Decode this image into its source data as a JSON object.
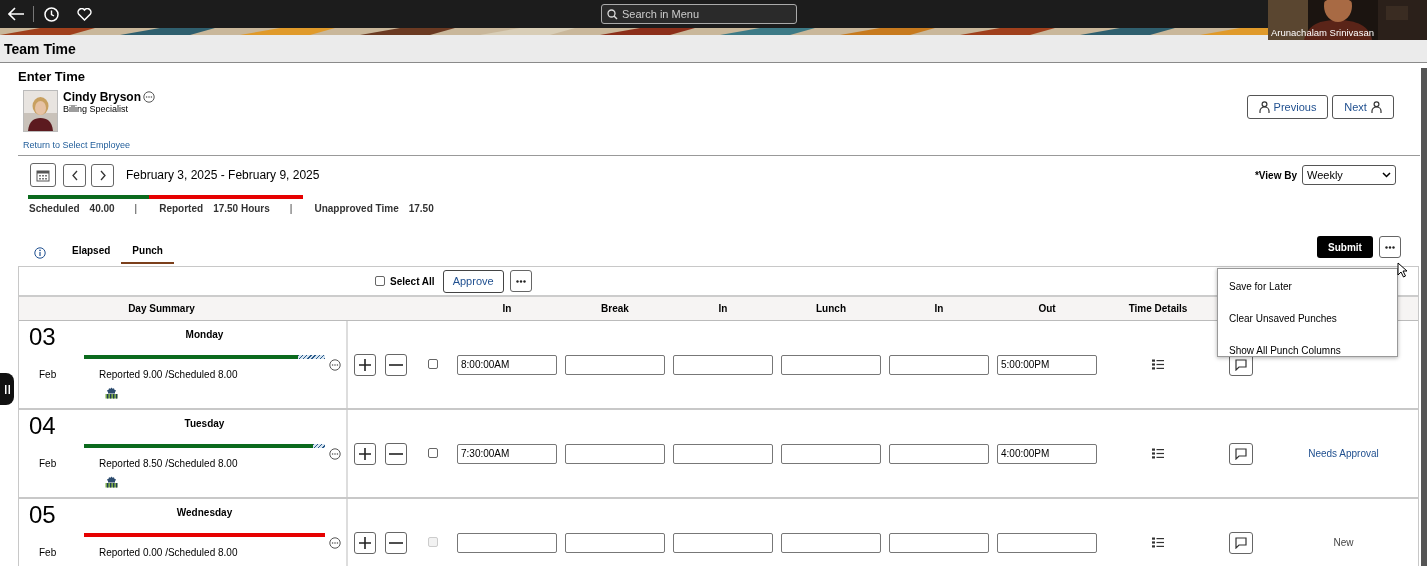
{
  "top_bar": {
    "search": {
      "placeholder": "Search in Menu"
    }
  },
  "video_overlay": {
    "participant": "Arunachalam Srinivasan"
  },
  "page_title": "Team Time",
  "section_title": "Enter Time",
  "employee": {
    "name": "Cindy Bryson",
    "job_title": "Billing Specialist",
    "return_link": "Return to Select Employee"
  },
  "nav_buttons": [
    {
      "label": "Previous"
    },
    {
      "label": "Next"
    }
  ],
  "period": {
    "range": "February 3, 2025 - February 9, 2025",
    "level": 0.44,
    "totals": [
      {
        "label": "Scheduled",
        "value": "40.00",
        "separator": "|"
      },
      {
        "label": "Reported",
        "value": "17.50 Hours",
        "separator": "|"
      },
      {
        "label": "Unapproved Time",
        "value": "17.50"
      }
    ]
  },
  "view_by": {
    "label": "*View By",
    "value": "Weekly"
  },
  "tabs": [
    {
      "label": "Elapsed",
      "selected": false
    },
    {
      "label": "Punch",
      "selected": true
    }
  ],
  "actions": {
    "submit": "Submit"
  },
  "toolbar": {
    "select_all": {
      "label": "Select All",
      "checked": false
    },
    "approve": "Approve"
  },
  "menu": {
    "items": [
      "Save for Later",
      "Clear Unsaved Punches",
      "Show All Punch Columns"
    ]
  },
  "table": {
    "columns": [
      "Day Summary",
      "In",
      "Break",
      "In",
      "Lunch",
      "In",
      "Out",
      "Time Details"
    ],
    "rows": [
      {
        "day": "03",
        "month": "Feb",
        "weekday": "Monday",
        "level": 0.89,
        "overage": true,
        "summary": "Reported 9.00 /Scheduled 8.00",
        "indicator": true,
        "checked": false,
        "disabled": false,
        "in": "8:00:00AM",
        "out": "5:00:00PM"
      },
      {
        "day": "04",
        "month": "Feb",
        "weekday": "Tuesday",
        "level": 0.95,
        "overage": true,
        "summary": "Reported 8.50 /Scheduled 8.00",
        "indicator": true,
        "checked": false,
        "disabled": false,
        "in": "7:30:00AM",
        "out": "4:00:00PM",
        "status": {
          "text": "Needs Approval",
          "kind": "link"
        }
      },
      {
        "day": "05",
        "month": "Feb",
        "weekday": "Wednesday",
        "level": 0,
        "overage": false,
        "summary": "Reported 0.00 /Scheduled 8.00",
        "indicator": false,
        "checked": false,
        "disabled": true,
        "status": {
          "text": "New",
          "kind": "plain"
        }
      }
    ]
  }
}
